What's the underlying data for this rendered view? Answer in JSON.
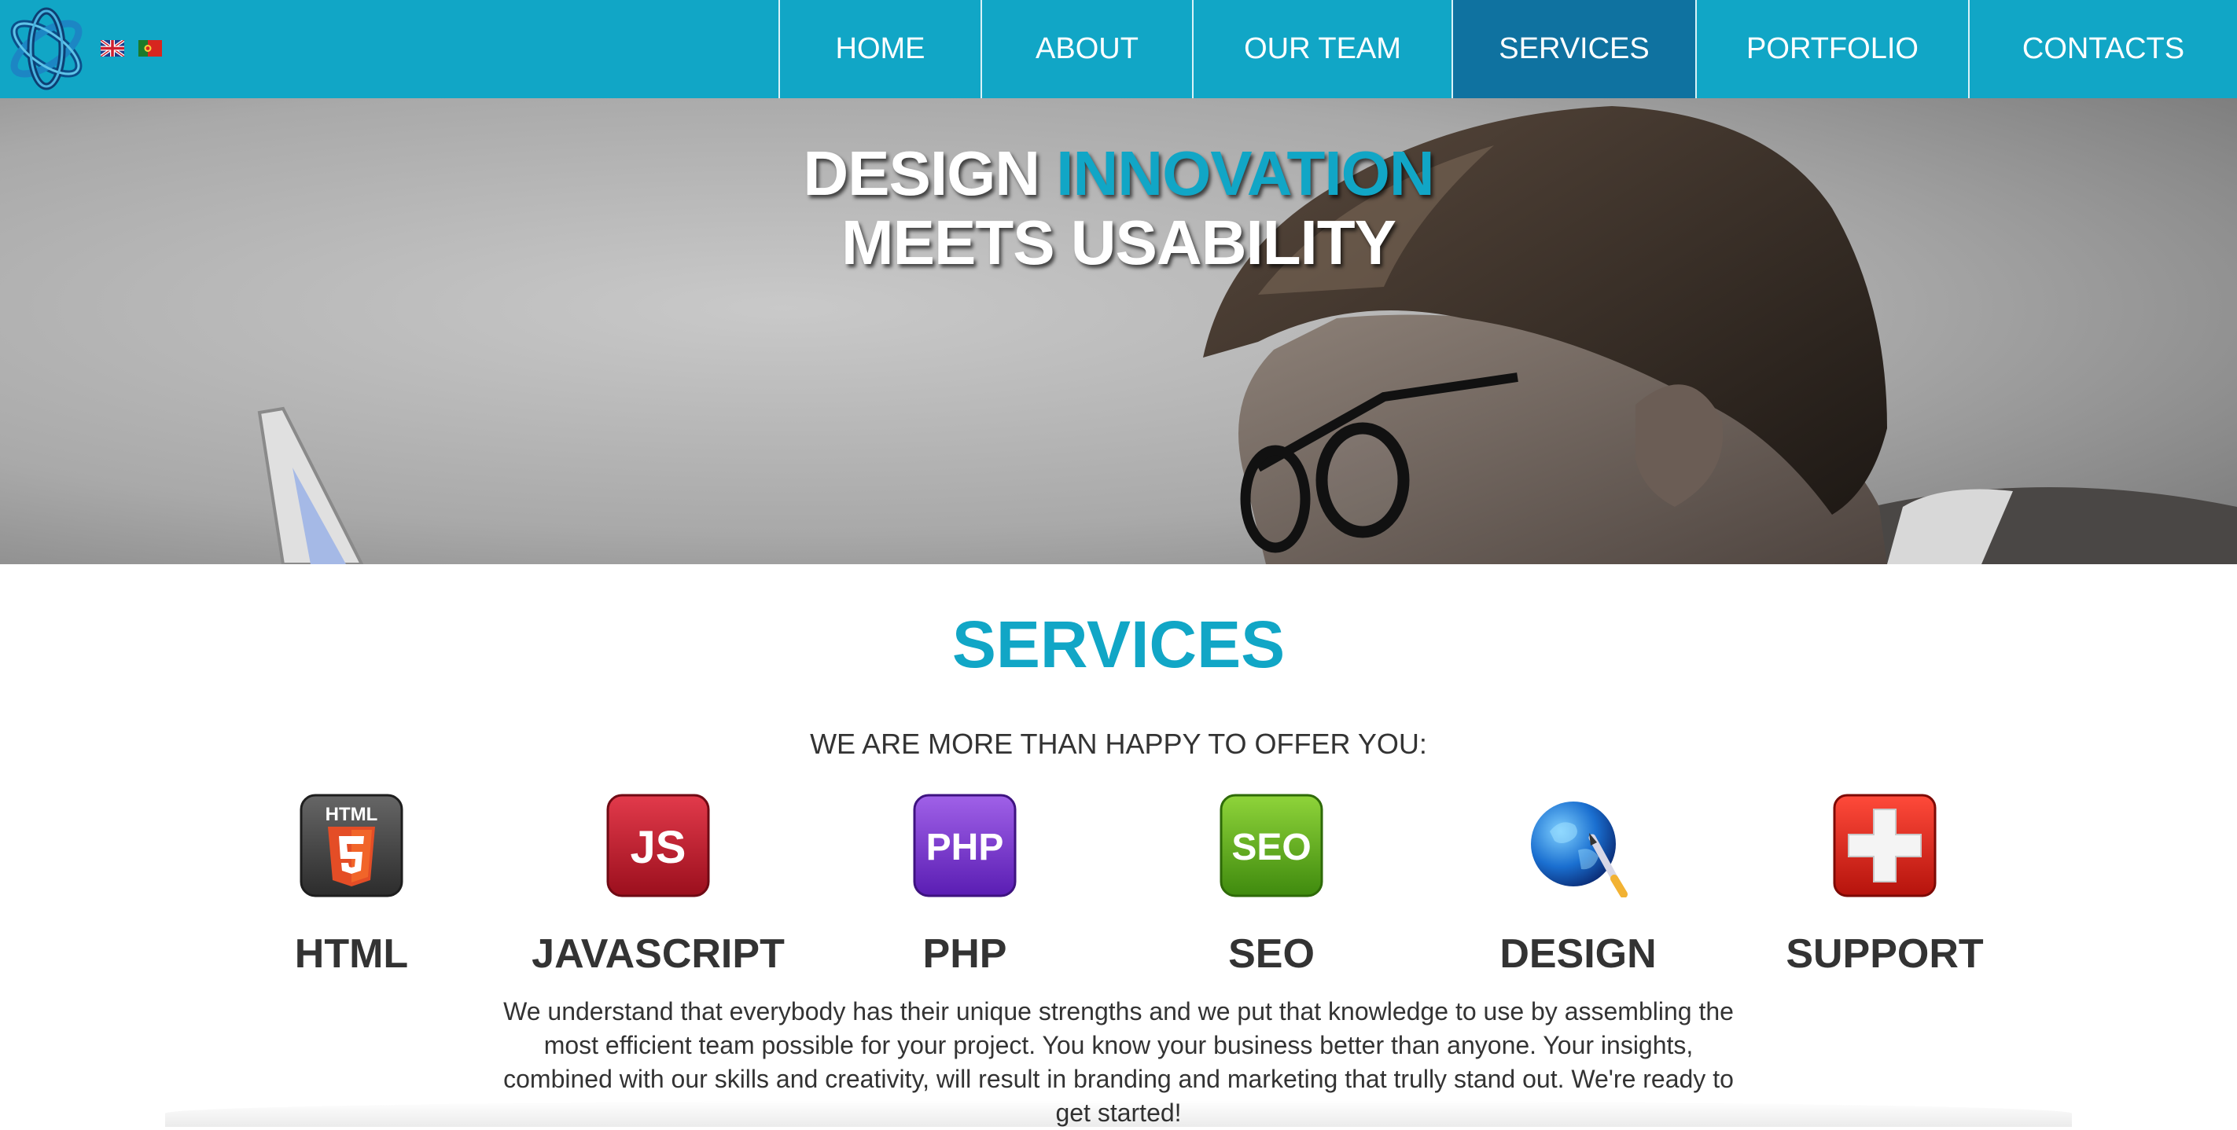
{
  "header": {
    "logo_icon": "atom-logo-icon",
    "languages": [
      {
        "icon": "uk-flag-icon",
        "code": "en"
      },
      {
        "icon": "portugal-flag-icon",
        "code": "pt"
      }
    ],
    "nav": [
      {
        "label": "HOME",
        "active": false
      },
      {
        "label": "ABOUT",
        "active": false
      },
      {
        "label": "OUR TEAM",
        "active": false
      },
      {
        "label": "SERVICES",
        "active": true
      },
      {
        "label": "PORTFOLIO",
        "active": false
      },
      {
        "label": "CONTACTS",
        "active": false
      }
    ]
  },
  "hero": {
    "title_word1": "DESIGN",
    "title_word2": "INNOVATION",
    "title_line2": "MEETS USABILITY"
  },
  "services": {
    "heading": "SERVICES",
    "subheading": "WE ARE MORE THAN HAPPY TO OFFER YOU:",
    "items": [
      {
        "name": "HTML",
        "icon": "html5-icon",
        "badge": "HTML"
      },
      {
        "name": "JAVASCRIPT",
        "icon": "javascript-icon",
        "badge": "JS"
      },
      {
        "name": "PHP",
        "icon": "php-icon",
        "badge": "PHP"
      },
      {
        "name": "SEO",
        "icon": "seo-icon",
        "badge": "SEO"
      },
      {
        "name": "DESIGN",
        "icon": "globe-brush-icon"
      },
      {
        "name": "SUPPORT",
        "icon": "red-cross-icon"
      }
    ],
    "description": "We understand that everybody has their unique strengths and we put that knowledge to use by assembling the most efficient team possible for your project. You know your business better than anyone. Your insights, combined with our skills and creativity, will result in branding and marketing that trully stand out. We're ready to get started!"
  },
  "colors": {
    "brand": "#11a6c6",
    "nav_active": "#0f72a0",
    "text": "#333333"
  }
}
